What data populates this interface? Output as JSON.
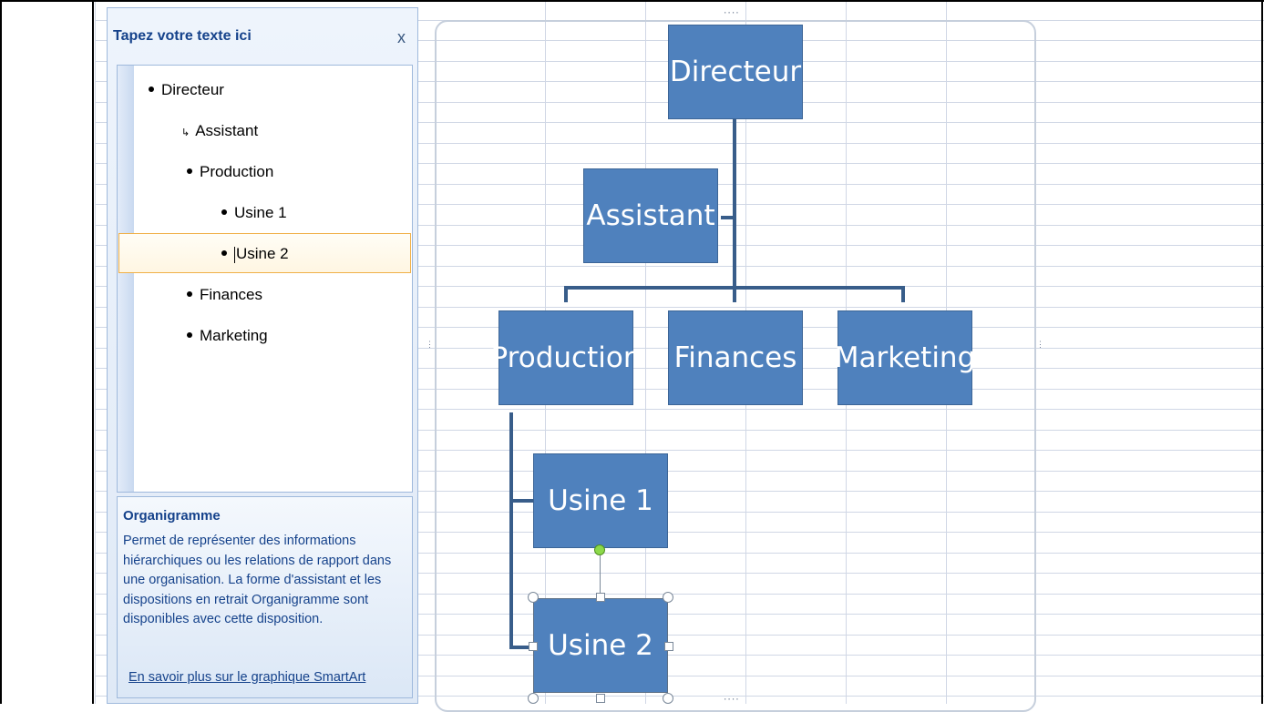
{
  "text_pane": {
    "title": "Tapez votre texte ici",
    "close_label": "x",
    "items": [
      {
        "label": "Directeur",
        "level": 1,
        "kind": "bullet"
      },
      {
        "label": "Assistant",
        "level": 2,
        "kind": "assistant"
      },
      {
        "label": "Production",
        "level": 2,
        "kind": "bullet"
      },
      {
        "label": "Usine 1",
        "level": 3,
        "kind": "bullet"
      },
      {
        "label": "Usine 2",
        "level": 3,
        "kind": "bullet",
        "selected": true
      },
      {
        "label": "Finances",
        "level": 2,
        "kind": "bullet"
      },
      {
        "label": "Marketing",
        "level": 2,
        "kind": "bullet"
      }
    ]
  },
  "description": {
    "title": "Organigramme",
    "text": "Permet de représenter des informations hiérarchiques ou les relations de rapport dans une organisation. La forme d'assistant et les dispositions en retrait Organigramme sont disponibles avec cette disposition.",
    "link": "En savoir plus sur le graphique SmartArt"
  },
  "diagram": {
    "boxes": {
      "directeur": "Directeur",
      "assistant": "Assistant",
      "production": "Production",
      "finances": "Finances",
      "marketing": "Marketing",
      "usine1": "Usine 1",
      "usine2": "Usine 2"
    },
    "selected_box": "Usine 2"
  },
  "colors": {
    "box_fill": "#4f81bd",
    "connector": "#385d8a",
    "pane_title": "#15428b",
    "selection": "#f0b048"
  }
}
